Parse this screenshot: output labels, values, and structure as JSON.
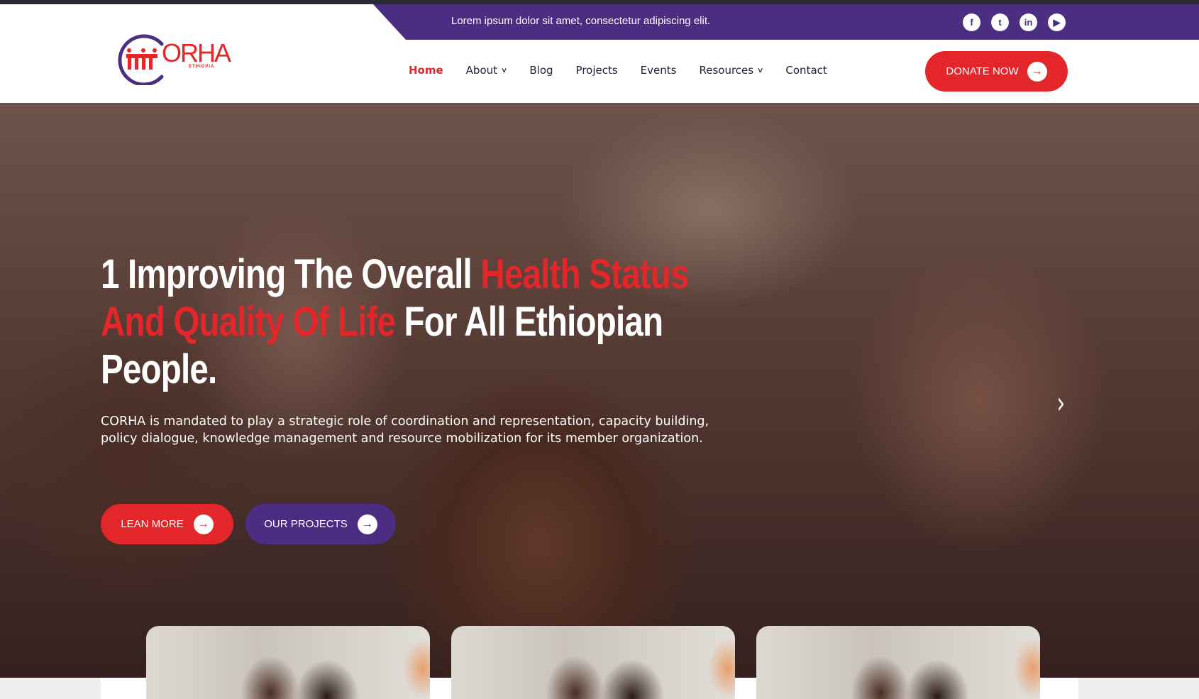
{
  "topbar": {
    "tagline": "Lorem ipsum dolor sit amet, consectetur adipiscing elit.",
    "socials": [
      {
        "icon": "facebook-icon",
        "glyph": "f"
      },
      {
        "icon": "twitter-icon",
        "glyph": "t"
      },
      {
        "icon": "linkedin-icon",
        "glyph": "in"
      },
      {
        "icon": "youtube-icon",
        "glyph": "▶"
      }
    ]
  },
  "logo": {
    "text": "ORHA",
    "sub": "ETHIOPIA"
  },
  "nav": {
    "items": [
      {
        "label": "Home",
        "active": true,
        "dropdown": false
      },
      {
        "label": "About",
        "active": false,
        "dropdown": true
      },
      {
        "label": "Blog",
        "active": false,
        "dropdown": false
      },
      {
        "label": "Projects",
        "active": false,
        "dropdown": false
      },
      {
        "label": "Events",
        "active": false,
        "dropdown": false
      },
      {
        "label": "Resources",
        "active": false,
        "dropdown": true
      },
      {
        "label": "Contact",
        "active": false,
        "dropdown": false
      }
    ]
  },
  "donate": {
    "label": "DONATE NOW"
  },
  "hero": {
    "title_part1": "1 Improving The Overall ",
    "title_highlight": "Health Status And Quality Of Life",
    "title_part2": " For All Ethiopian People.",
    "description": "CORHA is mandated to play a strategic role of coordination and representation, capacity building, policy dialogue, knowledge management and resource mobilization for its member organization.",
    "learn_label": "LEAN MORE",
    "projects_label": "OUR PROJECTS"
  },
  "colors": {
    "accent_red": "#e2262a",
    "brand_purple": "#4b2d82"
  }
}
